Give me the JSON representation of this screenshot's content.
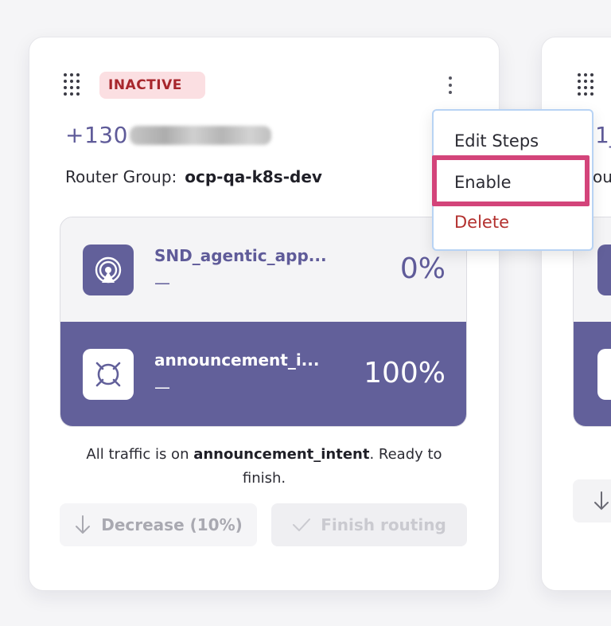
{
  "card": {
    "status_badge": "INACTIVE",
    "phone_prefix": "+130",
    "router_group_label": "Router Group:",
    "router_group_value": "ocp-qa-k8s-dev",
    "routes": [
      {
        "name": "SND_agentic_app...",
        "dash": "—",
        "percent": "0%",
        "icon": "broadcast-icon"
      },
      {
        "name": "announcement_i...",
        "dash": "—",
        "percent": "100%",
        "icon": "target-icon"
      }
    ],
    "info": {
      "prefix": "All traffic is on ",
      "intent": "announcement_intent",
      "suffix": ". Ready to finish."
    },
    "buttons": {
      "decrease": "Decrease (10%)",
      "finish": "Finish routing"
    }
  },
  "menu": {
    "edit": "Edit Steps",
    "enable": "Enable",
    "delete": "Delete"
  },
  "peek": {
    "phone": "1_",
    "router_group": "ou"
  },
  "colors": {
    "accent": "#62609a",
    "badge_bg": "#fbdfe2",
    "badge_text": "#a7262c",
    "delete_text": "#b3312f",
    "highlight": "#d3447a"
  }
}
